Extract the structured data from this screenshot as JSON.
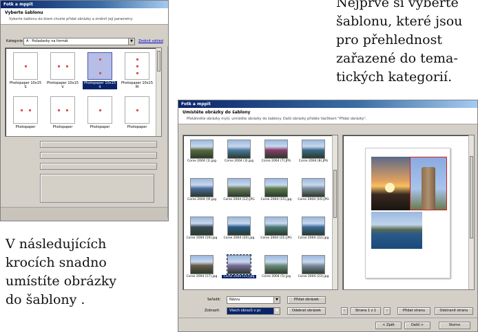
{
  "captions": {
    "top": [
      "Nejprve si vyberte",
      "šablonu, které jsou",
      "pro přehlednost",
      "zařazené do tema-",
      "tických kategorií."
    ],
    "bottom": [
      "V následujících",
      "krocích snadno",
      "umístíte obrázky",
      "do šablony ."
    ]
  },
  "window1": {
    "title": "Fotk a mppit",
    "header_title": "Vyberte šablonu",
    "header_subtitle": "Vyberte šablonu do které chcete přidat obrázky a změnit její parametry.",
    "category_label": "Kategorie",
    "category_value": "A · Požadavky na formát",
    "category_link": "Změnit vzhled",
    "templates": [
      {
        "label": "Photopaper 10x15 S",
        "selected": false
      },
      {
        "label": "Photopaper 10x15 V",
        "selected": false
      },
      {
        "label": "Photopaper 10x15 4",
        "selected": true
      },
      {
        "label": "Photopaper 10x15 M",
        "selected": false
      },
      {
        "label": "Photopaper",
        "selected": false
      },
      {
        "label": "Photopaper",
        "selected": false
      },
      {
        "label": "Photopaper",
        "selected": false
      },
      {
        "label": "Photopaper",
        "selected": false
      }
    ],
    "preview_slots": [
      "1",
      "2"
    ]
  },
  "window2": {
    "title": "Fotk a mppit",
    "header_title": "Umístěte obrázky do šablony",
    "header_subtitle": "Přetáhněte obrázky myší, umístěte obrázky do šablony. Další obrázky přidáte tlačítkem \"Přidat obrázky\".",
    "photos": [
      {
        "label": "Corse 2004 (1).jpg",
        "color": "#5a6a40",
        "selected": false
      },
      {
        "label": "Corse 2004 (3).jpg",
        "color": "#4a7aa0",
        "selected": false
      },
      {
        "label": "Corse 2004 (7).JPG",
        "color": "#8a3a6a",
        "selected": false
      },
      {
        "label": "Corse 2004 (8).JPG",
        "color": "#3a6a8a",
        "selected": false
      },
      {
        "label": "Corse 2004 (9).jpg",
        "color": "#4a6a9a",
        "selected": false
      },
      {
        "label": "Corse 2004 (12).JPG",
        "color": "#6a7a5a",
        "selected": false
      },
      {
        "label": "Corse 2004 (15).jpg",
        "color": "#5a7a4a",
        "selected": false
      },
      {
        "label": "Corse 2004 (16).JPG",
        "color": "#7a8a9a",
        "selected": false
      },
      {
        "label": "Corse 2004 (19).jpg",
        "color": "#3a4a5a",
        "selected": false
      },
      {
        "label": "Corse 2004 (20).jpg",
        "color": "#2a5a8a",
        "selected": false
      },
      {
        "label": "Corse 2004 (21).JPG",
        "color": "#4a7a7a",
        "selected": false
      },
      {
        "label": "Corse 2004 (22).jpg",
        "color": "#3a6a9a",
        "selected": false
      },
      {
        "label": "Corse 2004 (17).jpg",
        "color": "#6a5a4a",
        "selected": false
      },
      {
        "label": "Corse 2004 (11).jpg",
        "color": "#7a6a9a",
        "selected": true
      },
      {
        "label": "Corse 2004 (5).jpg",
        "color": "#6a8a7a",
        "selected": false
      },
      {
        "label": "Corse 2004 (23).jpg",
        "color": "#7a8aa0",
        "selected": false
      }
    ],
    "sort_label": "Seřadit:",
    "sort_value": "Názvu",
    "source_label": "Zobrazit:",
    "source_value": "Všech obrazů v pc",
    "btn_add_pictures": "Přidat obrázek",
    "btn_remove_pictures": "Odebrat obrázek",
    "btn_page": "Strana 1 z 1",
    "btn_add_page": "Přidat stranu",
    "btn_delete_page": "Odstranit stranu",
    "btn_back": "< Zpět",
    "btn_next": "Další >",
    "btn_cancel": "Storno"
  }
}
